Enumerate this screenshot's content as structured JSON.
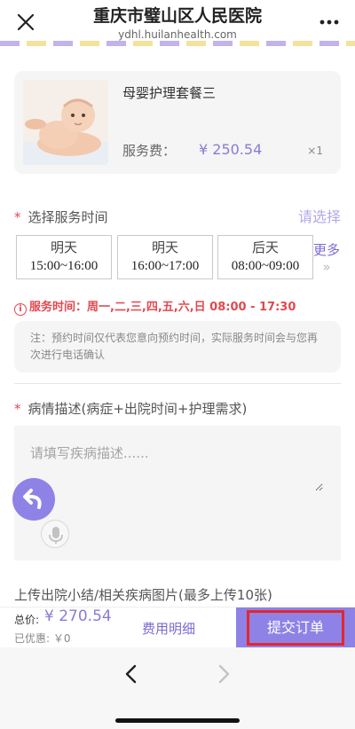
{
  "header": {
    "title": "重庆市璧山区人民医院",
    "subtitle": "ydhl.huilanhealth.com"
  },
  "product": {
    "name": "母婴护理套餐三",
    "fee_label": "服务费：",
    "fee_value": "¥ 250.54",
    "quantity": "×1"
  },
  "time_section": {
    "required_mark": "*",
    "title": "选择服务时间",
    "choose_label": "请选择",
    "slots": [
      {
        "day": "明天",
        "range": "15:00~16:00"
      },
      {
        "day": "明天",
        "range": "16:00~17:00"
      },
      {
        "day": "后天",
        "range": "08:00~09:00"
      }
    ],
    "more_label": "更多",
    "more_arrow": "»",
    "service_hours": "服务时间：周一,二,三,四,五,六,日 08:00 - 17:30",
    "notice": "注：预约时间仅代表您意向预约时间，实际服务时间会与您再次进行电话确认"
  },
  "description": {
    "required_mark": "*",
    "title": "病情描述(病症+出院时间+护理需求)",
    "placeholder": "请填写疾病描述......"
  },
  "upload": {
    "title": "上传出院小结/相关疾病图片(最多上传10张)"
  },
  "footer": {
    "total_label": "总价:",
    "total_value": "¥ 270.54",
    "discount": "已优惠: ￥0",
    "detail_label": "费用明细",
    "submit_label": "提交订单"
  },
  "colors": {
    "accent": "#8f82e6",
    "price": "#8b7ad6",
    "warning": "#e2484f",
    "highlight_border": "#e5262c"
  },
  "icons": {
    "close": "close-icon",
    "more": "more-dots-icon",
    "back_fab": "undo-arrow-icon",
    "mic": "microphone-icon",
    "nav_back": "chevron-left-icon",
    "nav_forward": "chevron-right-icon"
  }
}
